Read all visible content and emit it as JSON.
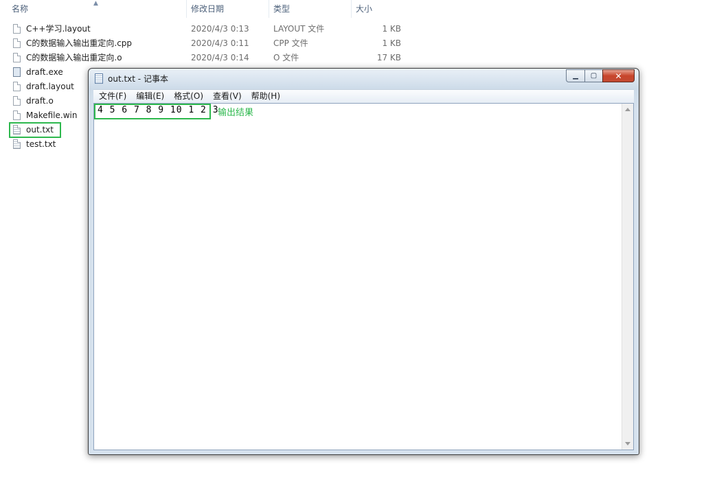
{
  "explorer": {
    "columns": {
      "name": "名称",
      "date": "修改日期",
      "type": "类型",
      "size": "大小"
    },
    "files": [
      {
        "name": "C++学习.layout",
        "date": "2020/4/3 0:13",
        "type": "LAYOUT 文件",
        "size": "1 KB",
        "icon": "file-icon"
      },
      {
        "name": "C的数据输入输出重定向.cpp",
        "date": "2020/4/3 0:11",
        "type": "CPP 文件",
        "size": "1 KB",
        "icon": "file-icon"
      },
      {
        "name": "C的数据输入输出重定向.o",
        "date": "2020/4/3 0:14",
        "type": "O 文件",
        "size": "17 KB",
        "icon": "file-icon"
      },
      {
        "name": "draft.exe",
        "date": "",
        "type": "",
        "size": "",
        "icon": "exe-icon"
      },
      {
        "name": "draft.layout",
        "date": "",
        "type": "",
        "size": "",
        "icon": "file-icon"
      },
      {
        "name": "draft.o",
        "date": "",
        "type": "",
        "size": "",
        "icon": "file-icon"
      },
      {
        "name": "Makefile.win",
        "date": "",
        "type": "",
        "size": "",
        "icon": "file-icon"
      },
      {
        "name": "out.txt",
        "date": "",
        "type": "",
        "size": "",
        "icon": "text-file-icon"
      },
      {
        "name": "test.txt",
        "date": "",
        "type": "",
        "size": "",
        "icon": "text-file-icon"
      }
    ]
  },
  "notepad": {
    "title": "out.txt - 记事本",
    "menu": [
      "文件(F)",
      "编辑(E)",
      "格式(O)",
      "查看(V)",
      "帮助(H)"
    ],
    "content": "4 5 6 7 8 9 10 1 2 3",
    "annotation": "输出结果",
    "controls": {
      "minimize": "▁",
      "maximize": "▢",
      "close": "✕"
    }
  },
  "colors": {
    "highlight": "#2db84d",
    "annotation_text": "#2db84d",
    "close_button": "#c7452b"
  }
}
